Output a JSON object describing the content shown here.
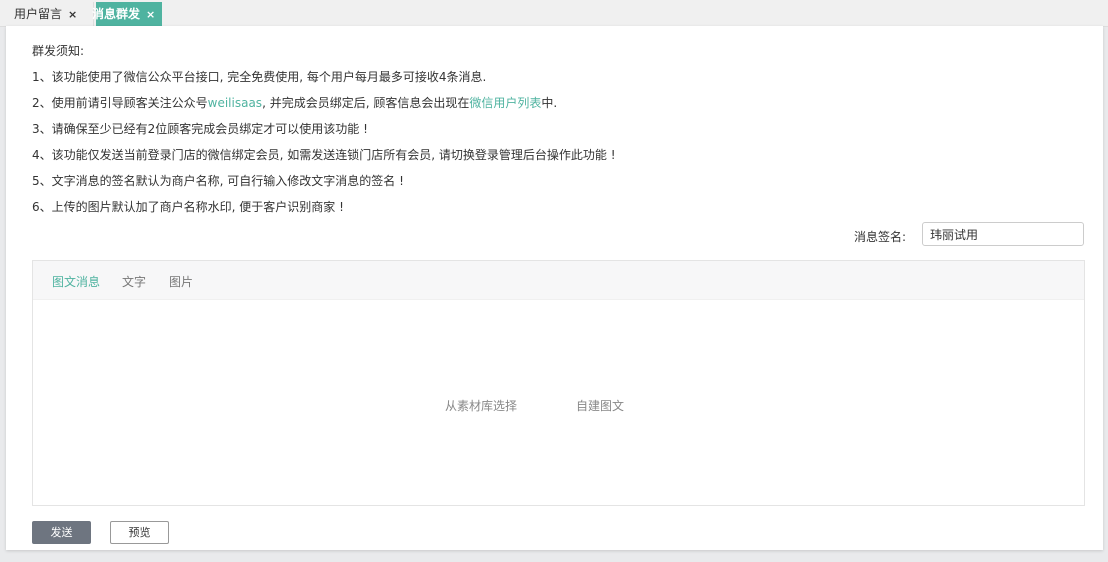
{
  "tabs": [
    {
      "label": "用户留言",
      "close": "×"
    },
    {
      "label": "消息群发",
      "close": "×"
    }
  ],
  "notice": {
    "title": "群发须知:",
    "lines": [
      "1、该功能使用了微信公众平台接口, 完全免费使用, 每个用户每月最多可接收4条消息.",
      {
        "before": "2、使用前请引导顾客关注公众号",
        "account": "weilisaas",
        "middle": ", 并完成会员绑定后, 顾客信息会出现在",
        "link": "微信用户列表",
        "after": "中."
      },
      "3、请确保至少已经有2位顾客完成会员绑定才可以使用该功能 !",
      "4、该功能仅发送当前登录门店的微信绑定会员, 如需发送连锁门店所有会员, 请切换登录管理后台操作此功能 !",
      "5、文字消息的签名默认为商户名称, 可自行输入修改文字消息的签名 !",
      "6、上传的图片默认加了商户名称水印, 便于客户识别商家 !"
    ]
  },
  "signature": {
    "label": "消息签名:",
    "value": "玮丽试用"
  },
  "editor": {
    "tabs": [
      "图文消息",
      "文字",
      "图片"
    ],
    "active_tab": 0,
    "actions": [
      "从素材库选择",
      "自建图文"
    ]
  },
  "buttons": {
    "send": "发送",
    "preview": "预览"
  },
  "colors": {
    "accent": "#4fb3a0",
    "send_button": "#6e7580"
  }
}
